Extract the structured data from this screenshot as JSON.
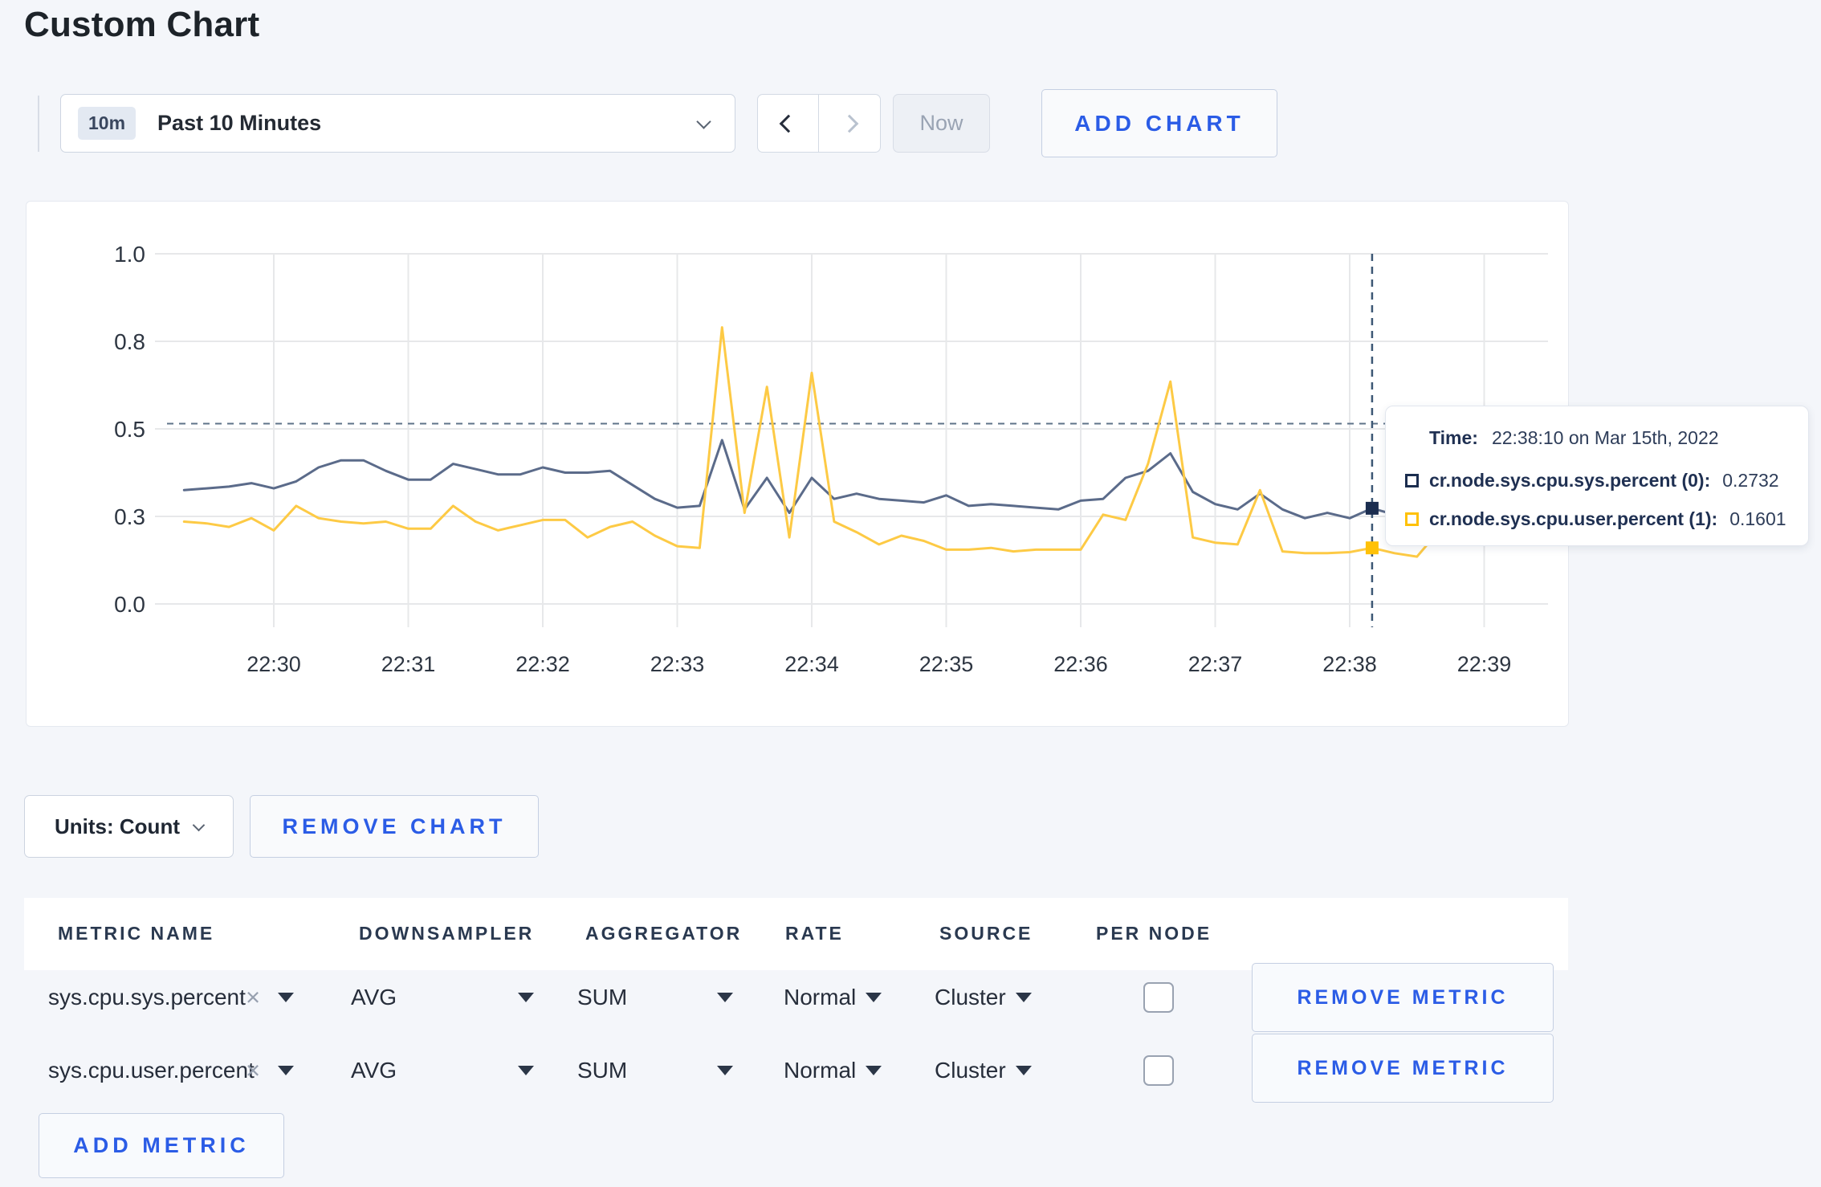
{
  "page": {
    "title": "Custom Chart",
    "background": "#f4f6fa",
    "accent_blue": "#2b5ce6"
  },
  "toolbar": {
    "range_badge": "10m",
    "range_label": "Past 10 Minutes",
    "now_label": "Now",
    "add_chart_label": "ADD CHART"
  },
  "chart_data": {
    "type": "line",
    "title": "",
    "grid": true,
    "legend_position": "tooltip-only",
    "x_axis": {
      "tick_labels": [
        "22:30",
        "22:31",
        "22:32",
        "22:33",
        "22:34",
        "22:35",
        "22:36",
        "22:37",
        "22:38",
        "22:39"
      ],
      "start_time": "22:29:20",
      "step_seconds": 10
    },
    "y_axis": {
      "tick_labels": [
        "0.0",
        "0.3",
        "0.5",
        "0.8",
        "1.0"
      ],
      "tick_values": [
        0,
        0.25,
        0.5,
        0.75,
        1
      ],
      "range": [
        0,
        1
      ]
    },
    "reference_line_value": 0.515,
    "hover": {
      "index": 53,
      "time": "22:38:10"
    },
    "series": [
      {
        "name": "cr.node.sys.cpu.sys.percent",
        "line_color": "#5b6b8a",
        "swatch_color": "#1b2d4f",
        "values": [
          0.325,
          0.33,
          0.335,
          0.345,
          0.33,
          0.35,
          0.39,
          0.41,
          0.41,
          0.38,
          0.355,
          0.355,
          0.4,
          0.385,
          0.37,
          0.37,
          0.39,
          0.375,
          0.375,
          0.38,
          0.34,
          0.3,
          0.275,
          0.28,
          0.468,
          0.27,
          0.36,
          0.26,
          0.36,
          0.3,
          0.315,
          0.3,
          0.295,
          0.29,
          0.31,
          0.28,
          0.285,
          0.28,
          0.275,
          0.27,
          0.295,
          0.3,
          0.36,
          0.38,
          0.43,
          0.32,
          0.285,
          0.27,
          0.315,
          0.27,
          0.245,
          0.26,
          0.245,
          0.2732,
          0.255,
          0.265,
          0.275,
          0.29,
          0.28,
          0.272,
          0.28,
          0.29
        ]
      },
      {
        "name": "cr.node.sys.cpu.user.percent",
        "line_color": "#fdca45",
        "swatch_color": "#ffc107",
        "values": [
          0.235,
          0.23,
          0.22,
          0.245,
          0.21,
          0.28,
          0.245,
          0.235,
          0.23,
          0.235,
          0.215,
          0.215,
          0.28,
          0.235,
          0.21,
          0.225,
          0.24,
          0.24,
          0.19,
          0.22,
          0.235,
          0.195,
          0.165,
          0.16,
          0.79,
          0.26,
          0.62,
          0.19,
          0.66,
          0.235,
          0.205,
          0.17,
          0.195,
          0.18,
          0.155,
          0.155,
          0.16,
          0.15,
          0.155,
          0.155,
          0.155,
          0.255,
          0.24,
          0.4,
          0.635,
          0.19,
          0.175,
          0.17,
          0.325,
          0.15,
          0.145,
          0.145,
          0.148,
          0.1601,
          0.145,
          0.135,
          0.21,
          0.27,
          0.21,
          0.205,
          0.255,
          0.265
        ]
      }
    ]
  },
  "tooltip": {
    "time_label": "Time:",
    "time_value": "22:38:10 on Mar 15th, 2022",
    "rows": [
      {
        "label": "cr.node.sys.cpu.sys.percent (0):",
        "value": "0.2732"
      },
      {
        "label": "cr.node.sys.cpu.user.percent (1):",
        "value": "0.1601"
      }
    ]
  },
  "chart_footer": {
    "units_label": "Units: Count",
    "remove_chart_label": "REMOVE CHART"
  },
  "metrics_table": {
    "headers": [
      "METRIC NAME",
      "DOWNSAMPLER",
      "AGGREGATOR",
      "RATE",
      "SOURCE",
      "PER NODE"
    ],
    "rows": [
      {
        "metric": "sys.cpu.sys.percent",
        "remove_icon": "×",
        "downsampler": "AVG",
        "aggregator": "SUM",
        "rate": "Normal",
        "source": "Cluster",
        "per_node_checked": false,
        "remove_label": "REMOVE METRIC"
      },
      {
        "metric": "sys.cpu.user.percent",
        "remove_icon": "×",
        "downsampler": "AVG",
        "aggregator": "SUM",
        "rate": "Normal",
        "source": "Cluster",
        "per_node_checked": false,
        "remove_label": "REMOVE METRIC"
      }
    ],
    "add_metric_label": "ADD METRIC"
  }
}
